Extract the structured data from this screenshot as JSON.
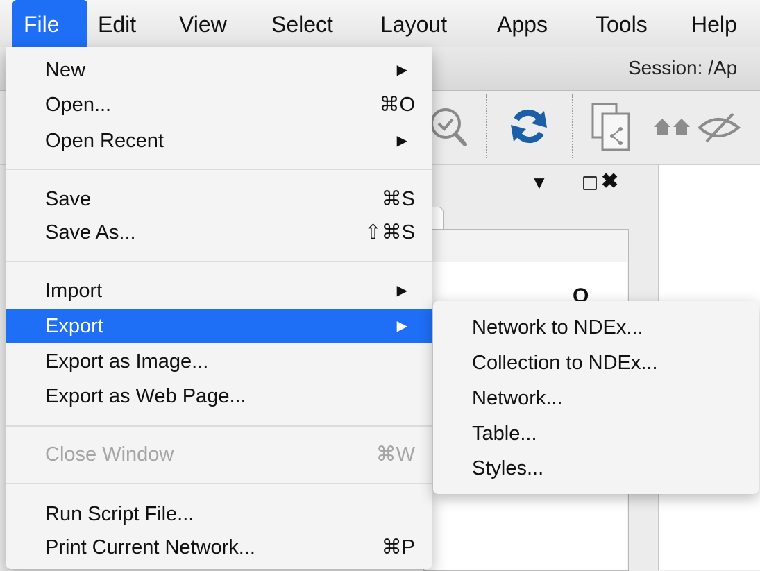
{
  "menubar": {
    "items": [
      "File",
      "Edit",
      "View",
      "Select",
      "Layout",
      "Apps",
      "Tools",
      "Help"
    ],
    "active": "File"
  },
  "window": {
    "session_label": "Session: /Ap"
  },
  "toolbar": {
    "icons": [
      "zoom-selected-icon",
      "refresh-icon",
      "new-network-from-selection-icon",
      "show-all-icon",
      "hide-icon"
    ]
  },
  "file_menu": {
    "groups": [
      [
        {
          "label": "New",
          "submenu": true
        },
        {
          "label": "Open...",
          "shortcut": "⌘O"
        },
        {
          "label": "Open Recent",
          "submenu": true
        }
      ],
      [
        {
          "label": "Save",
          "shortcut": "⌘S"
        },
        {
          "label": "Save As...",
          "shortcut": "⇧⌘S"
        }
      ],
      [
        {
          "label": "Import",
          "submenu": true
        },
        {
          "label": "Export",
          "submenu": true,
          "highlighted": true
        },
        {
          "label": "Export as Image..."
        },
        {
          "label": "Export as Web Page..."
        }
      ],
      [
        {
          "label": "Close Window",
          "shortcut": "⌘W",
          "disabled": true
        }
      ],
      [
        {
          "label": "Run Script File..."
        },
        {
          "label": "Print Current Network...",
          "shortcut": "⌘P"
        }
      ]
    ],
    "arrow_glyph": "▶"
  },
  "export_submenu": {
    "items": [
      "Network to NDEx...",
      "Collection to NDEx...",
      "Network...",
      "Table...",
      "Styles..."
    ]
  },
  "panel": {
    "dropdown_glyph": "▼",
    "close_glyph": "✖",
    "column_glyph": "O"
  },
  "colors": {
    "highlight": "#1e6ff5",
    "menu_bg": "#f4f4f4",
    "disabled_text": "#a5a5a5",
    "refresh_icon": "#1b5fa8"
  }
}
